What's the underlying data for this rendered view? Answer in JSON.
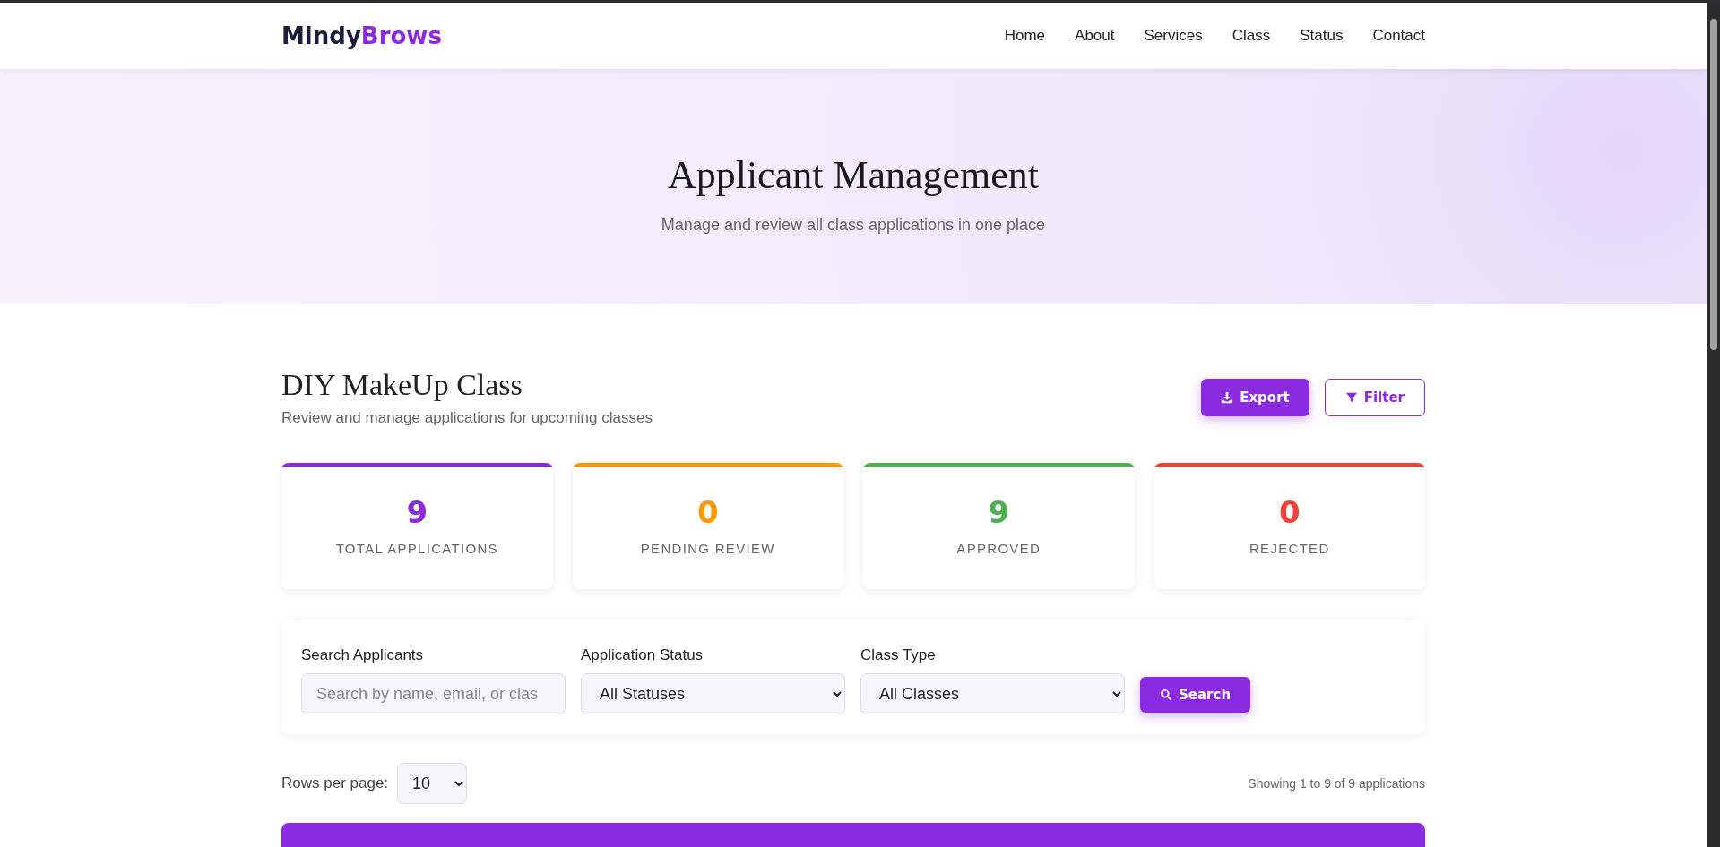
{
  "logo": {
    "first": "Mindy",
    "second": "Brows"
  },
  "nav": [
    "Home",
    "About",
    "Services",
    "Class",
    "Status",
    "Contact"
  ],
  "hero": {
    "title": "Applicant Management",
    "subtitle": "Manage and review all class applications in one place"
  },
  "section": {
    "title": "DIY MakeUp Class",
    "subtitle": "Review and manage applications for upcoming classes",
    "buttons": [
      {
        "label": "Export",
        "kind": "primary"
      },
      {
        "label": "Filter",
        "kind": "outline"
      }
    ]
  },
  "stats": [
    {
      "value": "9",
      "label": "TOTAL APPLICATIONS",
      "color": "#8a2be2"
    },
    {
      "value": "0",
      "label": "PENDING REVIEW",
      "color": "#ff9800"
    },
    {
      "value": "9",
      "label": "APPROVED",
      "color": "#4caf50"
    },
    {
      "value": "0",
      "label": "REJECTED",
      "color": "#f44336"
    }
  ],
  "filters": {
    "search": {
      "label": "Search Applicants",
      "placeholder": "Search by name, email, or clas"
    },
    "selects": [
      {
        "label": "Application Status",
        "value": "All Statuses"
      },
      {
        "label": "Class Type",
        "value": "All Classes"
      }
    ],
    "button": "Search"
  },
  "paging": {
    "label": "Rows per page:",
    "value": "10",
    "summary": "Showing 1 to 9 of 9 applications"
  }
}
